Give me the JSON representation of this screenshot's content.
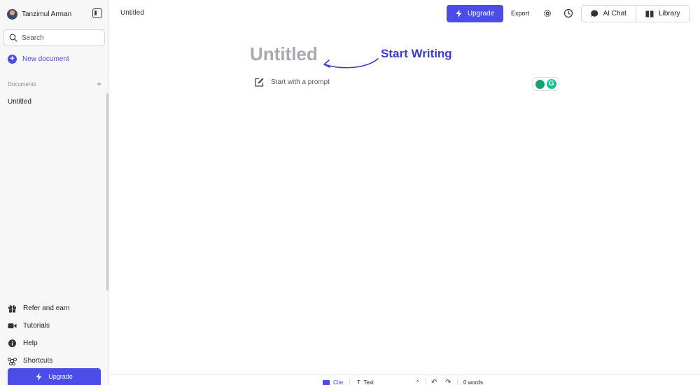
{
  "user": {
    "name": "Tanzimul Arman"
  },
  "sidebar": {
    "search_placeholder": "Search",
    "new_document_label": "New document",
    "documents_header": "Documents",
    "add_document_icon": "+",
    "documents": [
      "Untitled"
    ],
    "menu": [
      {
        "label": "Refer and earn",
        "icon": "gift-icon"
      },
      {
        "label": "Tutorials",
        "icon": "video-camera-icon"
      },
      {
        "label": "Help",
        "icon": "info-icon"
      },
      {
        "label": "Shortcuts",
        "icon": "command-key-icon"
      }
    ],
    "upgrade_label": "Upgrade"
  },
  "header": {
    "document_title": "Untitled",
    "upgrade_label": "Upgrade",
    "export_label": "Export",
    "ai_chat_label": "AI Chat",
    "library_label": "Library"
  },
  "editor": {
    "title_placeholder": "Untitled",
    "annotation": "Start Writing",
    "prompt_label": "Start with a prompt"
  },
  "footer": {
    "cite_label": "Cite",
    "text_style_label": "Text",
    "word_count": "0 words"
  },
  "colors": {
    "accent": "#4a4de8",
    "annotation": "#3a3ccf",
    "placeholder": "#a9a9b2",
    "grammarly": "#15c39a"
  }
}
